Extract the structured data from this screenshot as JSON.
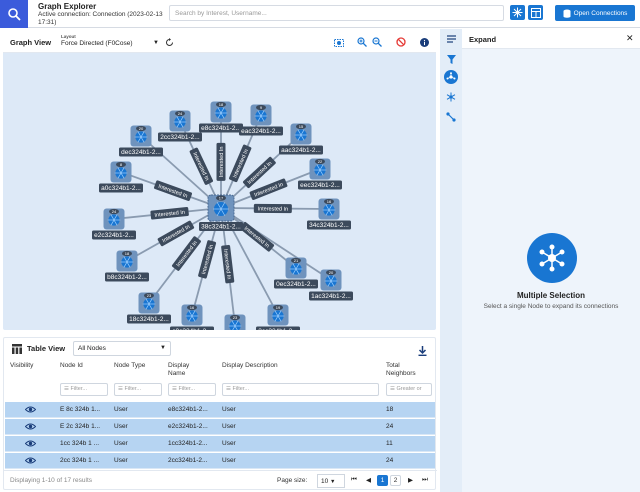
{
  "app": {
    "title": "Graph Explorer",
    "connection": "Active connection: Connection (2023-02-13 17:31)"
  },
  "topbar": {
    "search_placeholder": "Search by Interest, Username...",
    "open_connections_label": "Open Connections"
  },
  "graph_view": {
    "title": "Graph View",
    "layout_label": "Layout",
    "layout_value": "Force Directed (F0Cose)",
    "center_node": {
      "label": "38c324b1-2...",
      "badge": "17"
    },
    "nodes": [
      {
        "label": "2cc324b1-2...",
        "badge": "24"
      },
      {
        "label": "e8c324b1-2...",
        "badge": "18"
      },
      {
        "label": "eac324b1-2...",
        "badge": "9"
      },
      {
        "label": "aac324b1-2...",
        "badge": "15"
      },
      {
        "label": "eec324b1-2...",
        "badge": "22"
      },
      {
        "label": "34c324b1-2...",
        "badge": "16"
      },
      {
        "label": "0ec324b1-2...",
        "badge": "21"
      },
      {
        "label": "1ac324b1-2...",
        "badge": "20"
      },
      {
        "label": "3cc324b1-2...",
        "badge": "19"
      },
      {
        "label": "2cc324b1-2...",
        "badge": "23"
      },
      {
        "label": "c0c324b1-2...",
        "badge": "16"
      },
      {
        "label": "18c324b1-2...",
        "badge": "23"
      },
      {
        "label": "b8c324b1-2...",
        "badge": "18"
      },
      {
        "label": "e2c324b1-2...",
        "badge": "24"
      },
      {
        "label": "a0c324b1-2...",
        "badge": "8"
      },
      {
        "label": "dec324b1-2...",
        "badge": "20"
      }
    ],
    "edge_label": "Interested In"
  },
  "table_view": {
    "title": "Table View",
    "filter_select": "All Nodes",
    "columns": [
      "Visibility",
      "Node Id",
      "Node Type",
      "Display Name",
      "Display Description",
      "Total Neighbors"
    ],
    "filter_placeholder": "Filter...",
    "neighbors_filter_placeholder": "Greater or",
    "rows": [
      {
        "id": "E 8c 324b 1...",
        "type": "User",
        "name": "e8c324b1-2...",
        "desc": "User",
        "neighbors": "18"
      },
      {
        "id": "E 2c 324b 1...",
        "type": "User",
        "name": "e2c324b1-2...",
        "desc": "User",
        "neighbors": "24"
      },
      {
        "id": "1cc 324b 1 ...",
        "type": "User",
        "name": "1cc324b1-2...",
        "desc": "User",
        "neighbors": "11"
      },
      {
        "id": "2cc 324b 1 ...",
        "type": "User",
        "name": "2cc324b1-2...",
        "desc": "User",
        "neighbors": "24"
      }
    ],
    "footer": {
      "results": "Displaying 1-10 of 17 results",
      "page_size_label": "Page size:",
      "page_size": "10",
      "pages": [
        "1",
        "2"
      ]
    }
  },
  "expand_panel": {
    "title": "Expand",
    "heading": "Multiple Selection",
    "subtext": "Select a single Node to expand its connections"
  },
  "colors": {
    "accent": "#1976d2",
    "logo": "#3b5bdb",
    "node_tile": "#6f93bd",
    "label_bg": "#3c4a5c",
    "row_highlight": "#b6d4f2",
    "graph_bg": "#dde9f7"
  }
}
